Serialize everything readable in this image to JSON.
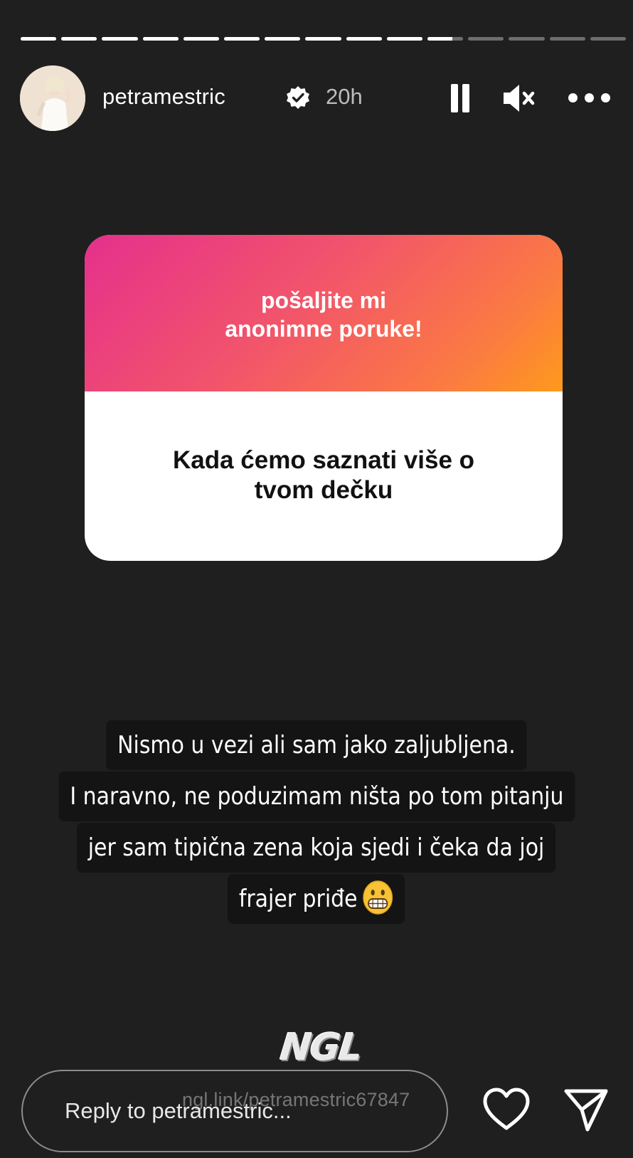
{
  "story": {
    "progress": {
      "segments_total": 15,
      "segments_complete": 10,
      "current_segment_fraction": 0.7
    },
    "header": {
      "username": "petramestric",
      "verified": true,
      "time_ago": "20h",
      "icons": {
        "avatar": "avatar",
        "verified": "verified-badge-icon",
        "pause": "pause-icon",
        "mute": "muted-speaker-icon",
        "more": "more-options-icon"
      }
    },
    "question_card": {
      "prompt": "pošaljite mi\nanonimne poruke!",
      "answer": "Kada ćemo saznati više o\ntvom dečku",
      "gradient_colors": [
        "#e5308c",
        "#f2556a",
        "#fb7a42",
        "#fe9a1c"
      ]
    },
    "caption": {
      "lines": [
        "Nismo u vezi ali sam jako zaljubljena.",
        "I naravno, ne poduzimam ništa po tom pitanju",
        "jer sam tipična zena koja sjedi i čeka da joj",
        "frajer priđe"
      ],
      "emoji": "grinning-face-emoji"
    },
    "watermark": {
      "logo_text": "NGL",
      "link": "ngl.link/petramestric67847"
    },
    "footer": {
      "reply_placeholder": "Reply to petramestric...",
      "icons": {
        "like": "heart-icon",
        "share": "send-icon"
      }
    }
  }
}
